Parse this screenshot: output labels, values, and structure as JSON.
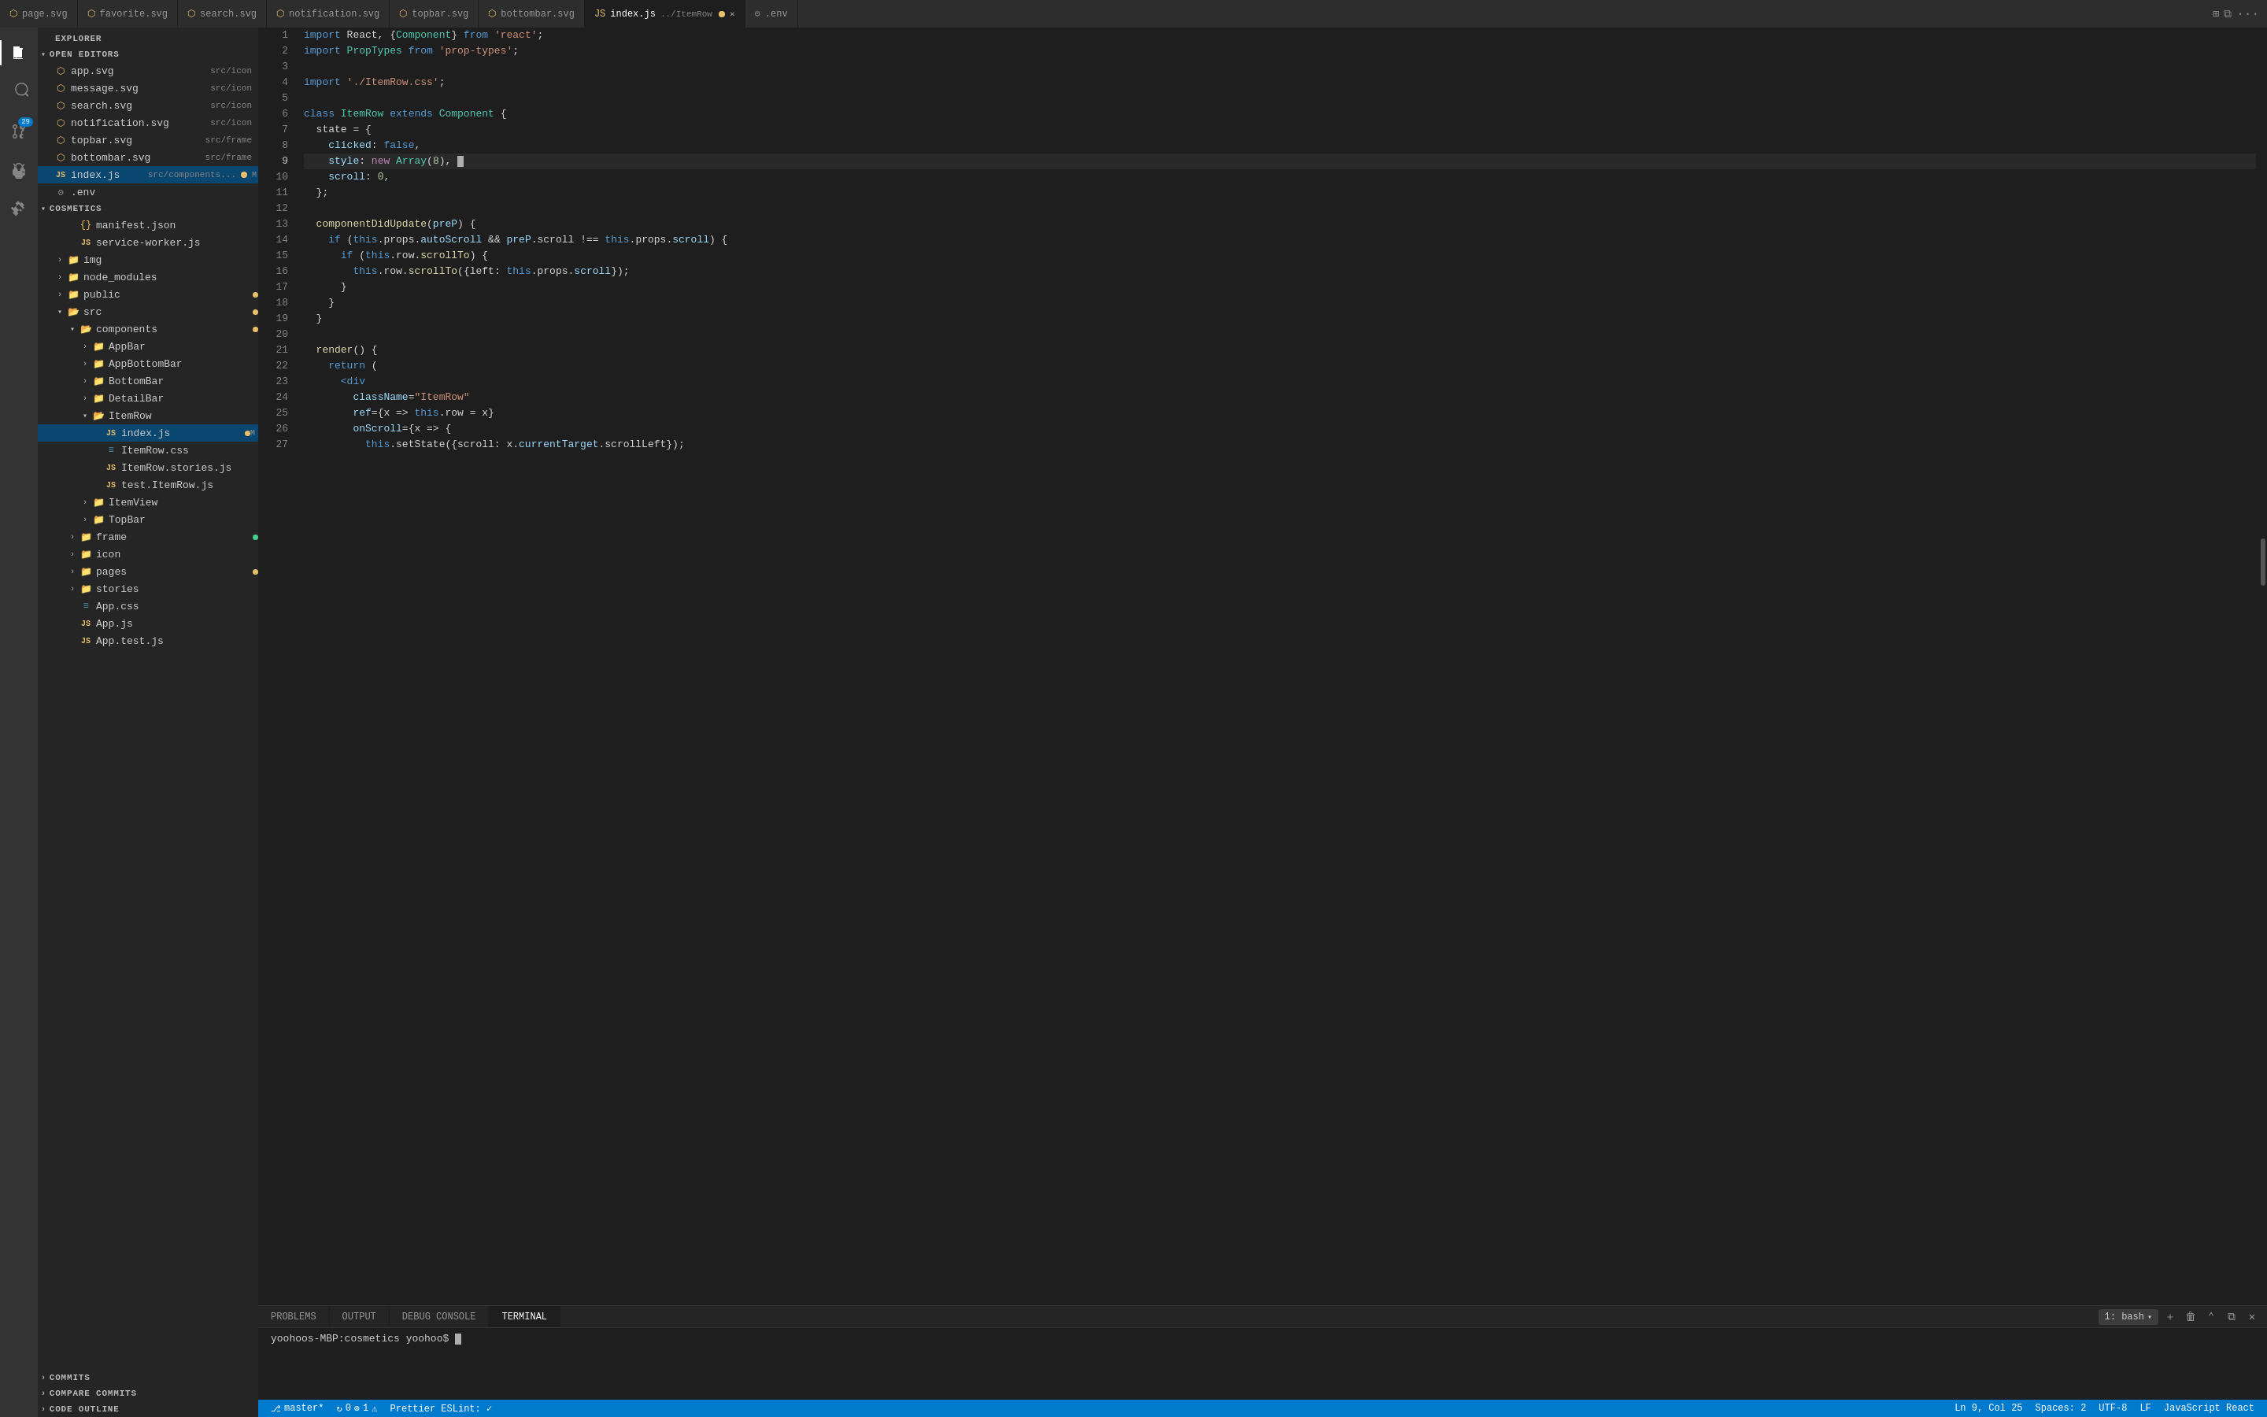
{
  "tabs": [
    {
      "id": "page-svg",
      "label": "page.svg",
      "active": false,
      "modified": false,
      "icon": "svg",
      "color": "#e8bf6a"
    },
    {
      "id": "favorite-svg",
      "label": "favorite.svg",
      "active": false,
      "modified": false,
      "icon": "svg",
      "color": "#e8bf6a"
    },
    {
      "id": "search-svg",
      "label": "search.svg",
      "active": false,
      "modified": false,
      "icon": "svg",
      "color": "#e8bf6a"
    },
    {
      "id": "notification-svg",
      "label": "notification.svg",
      "active": false,
      "modified": false,
      "icon": "svg",
      "color": "#e8bf6a"
    },
    {
      "id": "topbar-svg",
      "label": "topbar.svg",
      "active": false,
      "modified": false,
      "icon": "svg",
      "color": "#e8bf6a"
    },
    {
      "id": "bottombar-svg",
      "label": "bottombar.svg",
      "active": false,
      "modified": false,
      "icon": "svg",
      "color": "#e8bf6a"
    },
    {
      "id": "index-js",
      "label": "index.js",
      "path": "../ItemRow",
      "active": true,
      "modified": true,
      "icon": "js",
      "color": "#e8bf6a"
    },
    {
      "id": "env",
      "label": ".env",
      "active": false,
      "modified": false,
      "icon": "env",
      "color": "#e8bf6a"
    }
  ],
  "sidebar": {
    "title": "EXPLORER",
    "sections": [
      {
        "name": "OPEN EDITORS",
        "expanded": true,
        "items": [
          {
            "label": "app.svg",
            "suffix": "src/icon",
            "icon": "svg",
            "indent": 2
          },
          {
            "label": "message.svg",
            "suffix": "src/icon",
            "icon": "svg",
            "indent": 2
          },
          {
            "label": "search.svg",
            "suffix": "src/icon",
            "icon": "svg",
            "indent": 2
          },
          {
            "label": "notification.svg",
            "suffix": "src/icon",
            "icon": "svg",
            "indent": 2
          },
          {
            "label": "topbar.svg",
            "suffix": "src/frame",
            "icon": "svg",
            "indent": 2
          },
          {
            "label": "bottombar.svg",
            "suffix": "src/frame",
            "icon": "svg",
            "indent": 2
          },
          {
            "label": "index.js",
            "suffix": "src/components...",
            "icon": "js",
            "indent": 2,
            "modified": true,
            "selected": true
          },
          {
            "label": ".env",
            "suffix": "",
            "icon": "env",
            "indent": 2
          }
        ]
      },
      {
        "name": "COSMETICS",
        "expanded": true,
        "badge": "yellow",
        "items": [
          {
            "label": "manifest.json",
            "icon": "json",
            "indent": 3
          },
          {
            "label": "service-worker.js",
            "icon": "js",
            "indent": 3
          },
          {
            "label": "img",
            "icon": "folder",
            "indent": 2,
            "expandable": true
          },
          {
            "label": "node_modules",
            "icon": "folder",
            "indent": 2,
            "expandable": true
          },
          {
            "label": "public",
            "icon": "folder",
            "indent": 2,
            "expandable": true,
            "badge": "yellow"
          },
          {
            "label": "src",
            "icon": "folder-open",
            "indent": 2,
            "expandable": true,
            "expanded": true,
            "badge": "yellow"
          },
          {
            "label": "components",
            "icon": "folder-open",
            "indent": 3,
            "expandable": true,
            "expanded": true,
            "badge": "yellow"
          },
          {
            "label": "AppBar",
            "icon": "folder",
            "indent": 4,
            "expandable": true
          },
          {
            "label": "AppBottomBar",
            "icon": "folder",
            "indent": 4,
            "expandable": true
          },
          {
            "label": "BottomBar",
            "icon": "folder",
            "indent": 4,
            "expandable": true
          },
          {
            "label": "DetailBar",
            "icon": "folder",
            "indent": 4,
            "expandable": true
          },
          {
            "label": "ItemRow",
            "icon": "folder-open",
            "indent": 4,
            "expandable": true,
            "expanded": true
          },
          {
            "label": "index.js",
            "icon": "js",
            "indent": 6,
            "modified": true,
            "selected": true
          },
          {
            "label": "ItemRow.css",
            "icon": "css",
            "indent": 6
          },
          {
            "label": "ItemRow.stories.js",
            "icon": "js",
            "indent": 6
          },
          {
            "label": "test.ItemRow.js",
            "icon": "js",
            "indent": 6
          },
          {
            "label": "ItemView",
            "icon": "folder",
            "indent": 4,
            "expandable": true
          },
          {
            "label": "TopBar",
            "icon": "folder",
            "indent": 4,
            "expandable": true
          },
          {
            "label": "frame",
            "icon": "folder",
            "indent": 3,
            "expandable": true,
            "badge": "green"
          },
          {
            "label": "icon",
            "icon": "folder",
            "indent": 3,
            "expandable": true
          },
          {
            "label": "pages",
            "icon": "folder",
            "indent": 3,
            "expandable": true,
            "badge": "yellow"
          },
          {
            "label": "stories",
            "icon": "folder",
            "indent": 3,
            "expandable": true
          },
          {
            "label": "App.css",
            "icon": "css",
            "indent": 3
          },
          {
            "label": "App.js",
            "icon": "js",
            "indent": 3
          },
          {
            "label": "App.test.js",
            "icon": "js",
            "indent": 3
          }
        ]
      }
    ],
    "bottom_sections": [
      {
        "name": "COMMITS",
        "expanded": false
      },
      {
        "name": "COMPARE COMMITS",
        "expanded": false
      },
      {
        "name": "CODE OUTLINE",
        "expanded": false
      }
    ]
  },
  "editor": {
    "lines": [
      {
        "num": 1,
        "tokens": [
          {
            "text": "import ",
            "cls": "kw"
          },
          {
            "text": "React, {",
            "cls": "op"
          },
          {
            "text": "Component",
            "cls": "cls"
          },
          {
            "text": "} ",
            "cls": "op"
          },
          {
            "text": "from ",
            "cls": "kw2"
          },
          {
            "text": "'react'",
            "cls": "str"
          },
          {
            "text": ";",
            "cls": "op"
          }
        ]
      },
      {
        "num": 2,
        "tokens": [
          {
            "text": "import ",
            "cls": "kw"
          },
          {
            "text": "PropTypes ",
            "cls": "cls"
          },
          {
            "text": "from ",
            "cls": "kw2"
          },
          {
            "text": "'prop-types'",
            "cls": "str"
          },
          {
            "text": ";",
            "cls": "op"
          }
        ]
      },
      {
        "num": 3,
        "tokens": []
      },
      {
        "num": 4,
        "tokens": [
          {
            "text": "import ",
            "cls": "kw"
          },
          {
            "text": "'./ItemRow.css'",
            "cls": "str"
          },
          {
            "text": ";",
            "cls": "op"
          }
        ]
      },
      {
        "num": 5,
        "tokens": []
      },
      {
        "num": 6,
        "tokens": [
          {
            "text": "class ",
            "cls": "kw"
          },
          {
            "text": "ItemRow ",
            "cls": "cls"
          },
          {
            "text": "extends ",
            "cls": "kw"
          },
          {
            "text": "Component ",
            "cls": "cls"
          },
          {
            "text": "{",
            "cls": "op"
          }
        ]
      },
      {
        "num": 7,
        "tokens": [
          {
            "text": "  state = {",
            "cls": "op"
          }
        ]
      },
      {
        "num": 8,
        "tokens": [
          {
            "text": "    clicked: ",
            "cls": "prop"
          },
          {
            "text": "false",
            "cls": "bool"
          },
          {
            "text": ",",
            "cls": "op"
          }
        ]
      },
      {
        "num": 9,
        "tokens": [
          {
            "text": "    style: ",
            "cls": "prop"
          },
          {
            "text": "new ",
            "cls": "kw2"
          },
          {
            "text": "Array",
            "cls": "cls"
          },
          {
            "text": "(",
            "cls": "op"
          },
          {
            "text": "8",
            "cls": "num"
          },
          {
            "text": "),",
            "cls": "op"
          }
        ],
        "highlighted": true
      },
      {
        "num": 10,
        "tokens": [
          {
            "text": "    scroll: ",
            "cls": "prop"
          },
          {
            "text": "0",
            "cls": "num"
          },
          {
            "text": ",",
            "cls": "op"
          }
        ]
      },
      {
        "num": 11,
        "tokens": [
          {
            "text": "  };",
            "cls": "op"
          }
        ]
      },
      {
        "num": 12,
        "tokens": []
      },
      {
        "num": 13,
        "tokens": [
          {
            "text": "  componentDidUpdate",
            "cls": "fn"
          },
          {
            "text": "(",
            "cls": "op"
          },
          {
            "text": "preP",
            "cls": "prop"
          },
          {
            "text": ") {",
            "cls": "op"
          }
        ]
      },
      {
        "num": 14,
        "tokens": [
          {
            "text": "    if ",
            "cls": "kw"
          },
          {
            "text": "(",
            "cls": "op"
          },
          {
            "text": "this",
            "cls": "kw"
          },
          {
            "text": ".props.",
            "cls": "op"
          },
          {
            "text": "autoScroll",
            "cls": "prop"
          },
          {
            "text": " && ",
            "cls": "op"
          },
          {
            "text": "preP",
            "cls": "prop"
          },
          {
            "text": ".scroll ",
            "cls": "op"
          },
          {
            "text": "!== ",
            "cls": "op"
          },
          {
            "text": "this",
            "cls": "kw"
          },
          {
            "text": ".props.",
            "cls": "op"
          },
          {
            "text": "scroll",
            "cls": "prop"
          },
          {
            "text": ") {",
            "cls": "op"
          }
        ]
      },
      {
        "num": 15,
        "tokens": [
          {
            "text": "      if ",
            "cls": "kw"
          },
          {
            "text": "(",
            "cls": "op"
          },
          {
            "text": "this",
            "cls": "kw"
          },
          {
            "text": ".row.",
            "cls": "op"
          },
          {
            "text": "scrollTo",
            "cls": "fn"
          },
          {
            "text": ") {",
            "cls": "op"
          }
        ]
      },
      {
        "num": 16,
        "tokens": [
          {
            "text": "        this",
            "cls": "kw"
          },
          {
            "text": ".row.",
            "cls": "op"
          },
          {
            "text": "scrollTo",
            "cls": "fn"
          },
          {
            "text": "({left: ",
            "cls": "op"
          },
          {
            "text": "this",
            "cls": "kw"
          },
          {
            "text": ".props.",
            "cls": "op"
          },
          {
            "text": "scroll",
            "cls": "prop"
          },
          {
            "text": "});",
            "cls": "op"
          }
        ]
      },
      {
        "num": 17,
        "tokens": [
          {
            "text": "      }",
            "cls": "op"
          }
        ]
      },
      {
        "num": 18,
        "tokens": [
          {
            "text": "    }",
            "cls": "op"
          }
        ]
      },
      {
        "num": 19,
        "tokens": [
          {
            "text": "  }",
            "cls": "op"
          }
        ]
      },
      {
        "num": 20,
        "tokens": []
      },
      {
        "num": 21,
        "tokens": [
          {
            "text": "  render",
            "cls": "fn"
          },
          {
            "text": "() {",
            "cls": "op"
          }
        ]
      },
      {
        "num": 22,
        "tokens": [
          {
            "text": "    return ",
            "cls": "kw"
          },
          {
            "text": "(",
            "cls": "op"
          }
        ]
      },
      {
        "num": 23,
        "tokens": [
          {
            "text": "      <div",
            "cls": "jsx-tag"
          }
        ]
      },
      {
        "num": 24,
        "tokens": [
          {
            "text": "        className",
            "cls": "jsx-attr"
          },
          {
            "text": "=",
            "cls": "op"
          },
          {
            "text": "\"ItemRow\"",
            "cls": "jsx-str"
          }
        ]
      },
      {
        "num": 25,
        "tokens": [
          {
            "text": "        ref",
            "cls": "jsx-attr"
          },
          {
            "text": "={x => ",
            "cls": "op"
          },
          {
            "text": "this",
            "cls": "kw"
          },
          {
            "text": ".row = x}",
            "cls": "op"
          }
        ]
      },
      {
        "num": 26,
        "tokens": [
          {
            "text": "        onScroll",
            "cls": "jsx-attr"
          },
          {
            "text": "={x => {",
            "cls": "op"
          }
        ]
      },
      {
        "num": 27,
        "tokens": [
          {
            "text": "          this",
            "cls": "kw"
          },
          {
            "text": ".setState({scroll: x.",
            "cls": "op"
          },
          {
            "text": "currentTarget",
            "cls": "prop"
          },
          {
            "text": ".scrollLeft});",
            "cls": "op"
          }
        ]
      }
    ]
  },
  "panel": {
    "tabs": [
      "PROBLEMS",
      "OUTPUT",
      "DEBUG CONSOLE",
      "TERMINAL"
    ],
    "active_tab": "TERMINAL",
    "terminal_instance": "1: bash",
    "terminal_line": "yoohoos-MBP:cosmetics yoohoo$"
  },
  "status_bar": {
    "branch": "master*",
    "sync": "0",
    "errors": "0",
    "warnings": "1",
    "prettier": "Prettier ESLint: ✓",
    "position": "Ln 9, Col 25",
    "spaces": "Spaces: 2",
    "encoding": "UTF-8",
    "eol": "LF",
    "language": "JavaScript React"
  },
  "activity_bar": {
    "items": [
      {
        "icon": "files",
        "label": "Explorer",
        "active": true
      },
      {
        "icon": "search",
        "label": "Search",
        "active": false
      },
      {
        "icon": "source-control",
        "label": "Source Control",
        "active": false,
        "badge": "29"
      },
      {
        "icon": "debug",
        "label": "Run and Debug",
        "active": false
      },
      {
        "icon": "extensions",
        "label": "Extensions",
        "active": false
      }
    ]
  },
  "colors": {
    "accent": "#007acc",
    "tab_active_bg": "#1e1e1e",
    "tab_inactive_bg": "#2d2d2d",
    "sidebar_bg": "#252526",
    "editor_bg": "#1e1e1e",
    "selected_row": "#094771",
    "modified_dot": "#e8bf6a"
  }
}
